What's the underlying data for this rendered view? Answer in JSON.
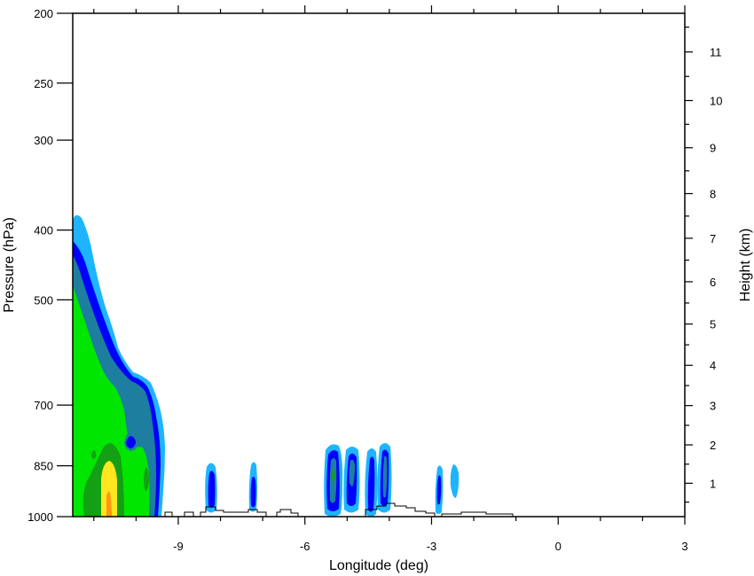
{
  "chart_data": {
    "type": "contour",
    "xlabel": "Longitude (deg)",
    "ylabel_left": "Pressure (hPa)",
    "ylabel_right": "Height (km)",
    "x_range": [
      -11.5,
      3
    ],
    "x_ticks": [
      -9,
      -6,
      -3,
      0,
      3
    ],
    "x_tick_labels": [
      "-9",
      "-6",
      "-3",
      "0",
      "3"
    ],
    "p_range": [
      200,
      1000
    ],
    "p_scale": "log",
    "p_ticks": [
      200,
      250,
      300,
      400,
      500,
      700,
      850,
      1000
    ],
    "p_tick_labels": [
      "200",
      "250",
      "300",
      "400",
      "500",
      "700",
      "850",
      "1000"
    ],
    "height_ticks": [
      1,
      2,
      3,
      4,
      5,
      6,
      7,
      8,
      9,
      10,
      11
    ],
    "height_tick_labels": [
      "1",
      "2",
      "3",
      "4",
      "5",
      "6",
      "7",
      "8",
      "9",
      "10",
      "11"
    ],
    "fill_colors": [
      "#1eb4ff",
      "#0000ff",
      "#1e7ea0",
      "#00e600",
      "#14a014",
      "#ffe61e",
      "#ff9614"
    ],
    "terrain_color": "#000000",
    "grid": false,
    "legend": "none"
  }
}
